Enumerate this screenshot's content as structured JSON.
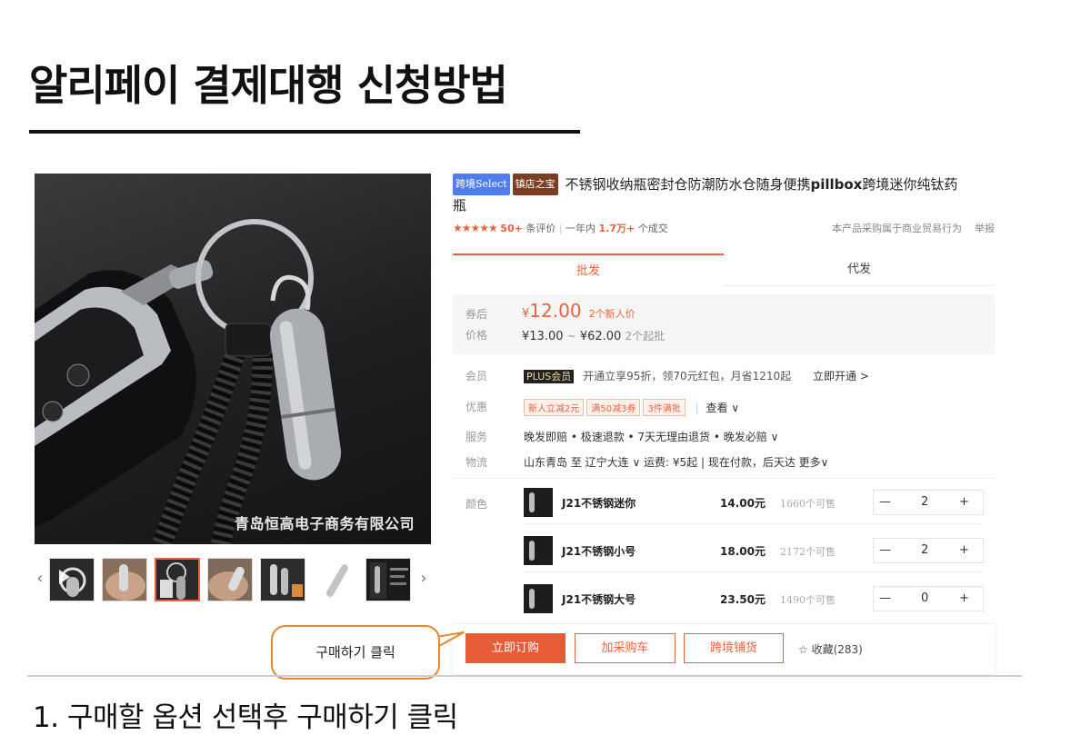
{
  "page": {
    "title": "알리페이 결제대행 신청방법",
    "step_text": "1. 구매할 옵션 선택후 구매하기 클릭",
    "callout": "구매하기 클릭"
  },
  "product": {
    "watermark": "青岛恒高电子商务有限公司",
    "badge_select": "跨境Select",
    "badge_shop": "镇店之宝",
    "title_part1": "不锈钢收纳瓶密封仓防潮防水仓随身便携",
    "title_bold": "pillbox",
    "title_part2": "跨境迷你纯钛药瓶",
    "stars": "★★★★★",
    "review_count": "50+",
    "review_label": "条评价",
    "year_label": "一年内",
    "sold_count": "1.7万+",
    "sold_label": "个成交",
    "right_note": "本产品采购属于商业贸易行为",
    "report": "举报"
  },
  "tabs": {
    "wholesale": "批发",
    "dropship": "代发"
  },
  "price": {
    "label_coupon": "券后",
    "label_price": "价格",
    "currency": "¥",
    "coupon_price": "12.00",
    "coupon_note": "2个新人价",
    "range_low": "¥13.00",
    "range_sep": "~",
    "range_high": "¥62.00",
    "min_order": "2个起批"
  },
  "details": {
    "member_label": "会员",
    "plus_badge": "PLUS会员",
    "member_text": "开通立享95折，领70元红包，月省1210起",
    "member_link": "立即开通 >",
    "promo_label": "优惠",
    "coupons": [
      "新人立减2元",
      "满50减3券",
      "3件满批"
    ],
    "promo_view": "查看 ∨",
    "service_label": "服务",
    "service_text": "晚发即赔 • 极速退款 • 7天无理由退货 • 晚发必赔 ∨",
    "logistics_label": "物流",
    "logistics_text": "山东青岛 至 辽宁大连 ∨  运费: ¥5起 | 现在付款，后天达 更多∨",
    "color_label": "颜色"
  },
  "skus": [
    {
      "name": "J21不锈钢迷你",
      "price": "14.00元",
      "stock": "1660个可售",
      "qty": "2"
    },
    {
      "name": "J21不锈钢小号",
      "price": "18.00元",
      "stock": "2172个可售",
      "qty": "2"
    },
    {
      "name": "J21不锈钢大号",
      "price": "23.50元",
      "stock": "1490个可售",
      "qty": "0"
    }
  ],
  "stepper": {
    "minus": "—",
    "plus": "+"
  },
  "actions": {
    "buy_now": "立即订购",
    "add_cart": "加采购车",
    "cross_border": "跨境铺货",
    "favorite": "☆ 收藏(283)"
  },
  "thumb_arrows": {
    "prev": "‹",
    "next": "›"
  },
  "colors": {
    "accent": "#e8623d",
    "callout_border": "#e8862e"
  }
}
